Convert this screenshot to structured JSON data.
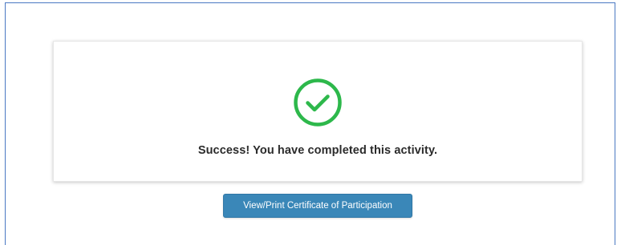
{
  "status": {
    "message": "Success! You have completed this activity.",
    "icon": "check-circle-icon",
    "icon_color": "#2db84b"
  },
  "actions": {
    "certificate_label": "View/Print Certificate of Participation",
    "button_color": "#3a87b8"
  },
  "colors": {
    "frame_border": "#4a78c2"
  }
}
